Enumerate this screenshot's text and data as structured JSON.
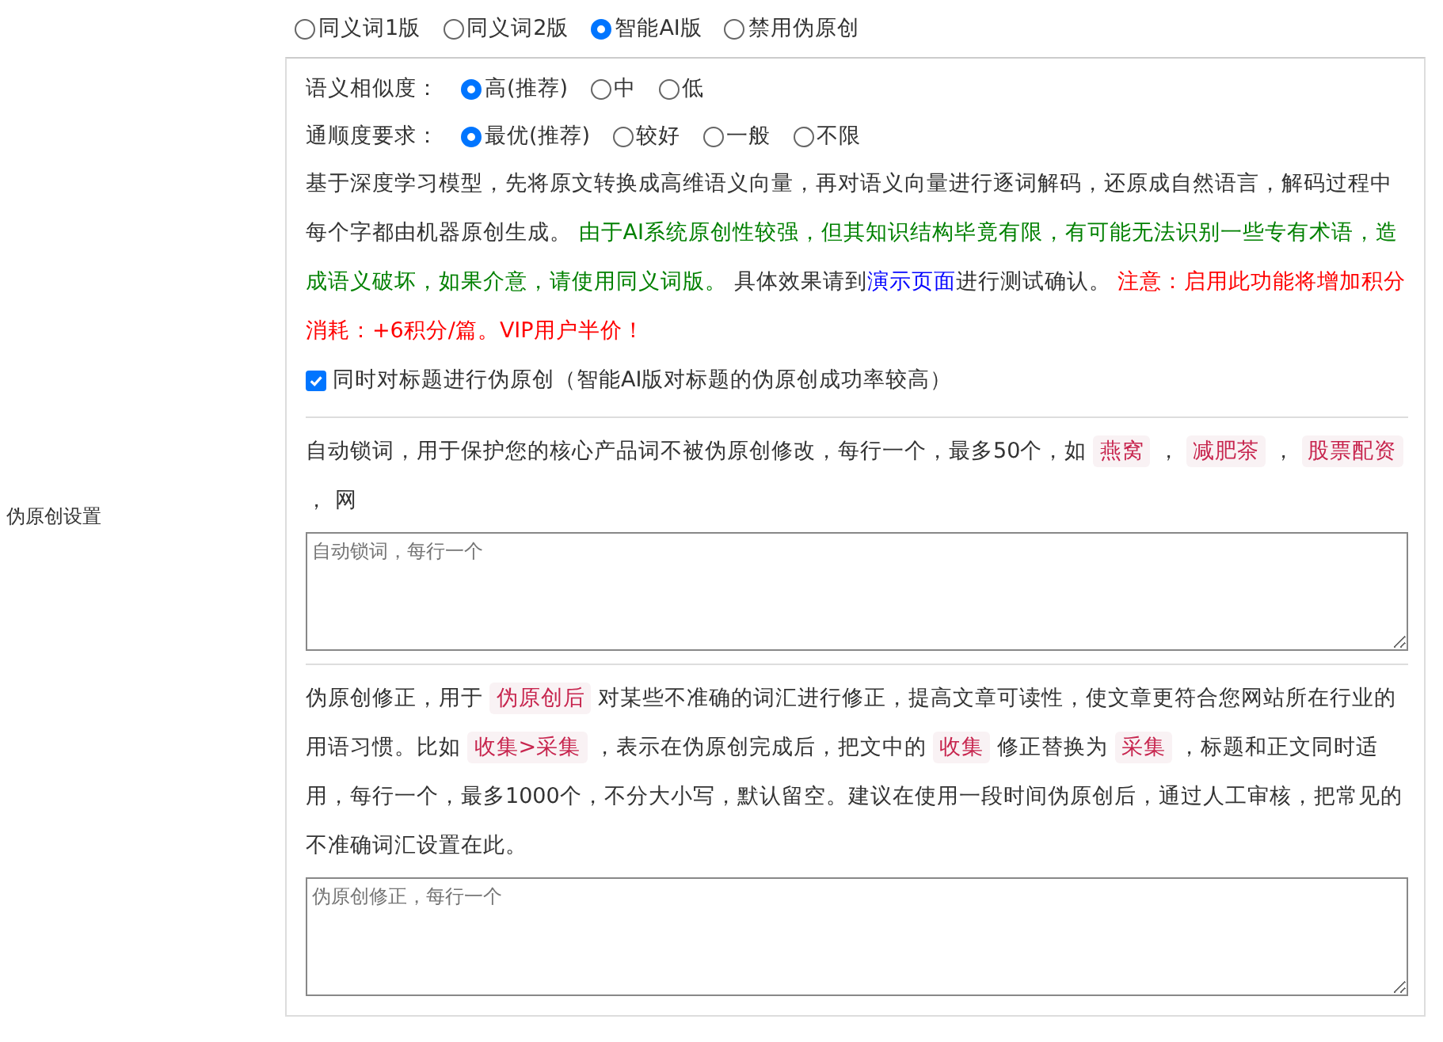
{
  "modes": [
    {
      "label": "同义词1版",
      "selected": false
    },
    {
      "label": "同义词2版",
      "selected": false
    },
    {
      "label": "智能AI版",
      "selected": true
    },
    {
      "label": "禁用伪原创",
      "selected": false
    }
  ],
  "similarity": {
    "label": "语义相似度：",
    "options": [
      {
        "label": "高(推荐)",
        "selected": true
      },
      {
        "label": "中",
        "selected": false
      },
      {
        "label": "低",
        "selected": false
      }
    ]
  },
  "fluency": {
    "label": "通顺度要求：",
    "options": [
      {
        "label": "最优(推荐)",
        "selected": true
      },
      {
        "label": "较好",
        "selected": false
      },
      {
        "label": "一般",
        "selected": false
      },
      {
        "label": "不限",
        "selected": false
      }
    ]
  },
  "ai_description": [
    {
      "kind": "plain",
      "text": "基于深度学习模型，先将原文转换成高维语义向量，再对语义向量进行逐词解码，还原成自然语言，解码过程中每个字都由机器原创生成。 "
    },
    {
      "kind": "note",
      "text": "由于AI系统原创性较强，但其知识结构毕竟有限，有可能无法识别一些专有术语，造成语义破坏，如果介意，请使用同义词版。"
    },
    {
      "kind": "plain",
      "text": " 具体效果请到"
    },
    {
      "kind": "link",
      "text": "演示页面"
    },
    {
      "kind": "plain",
      "text": "进行测试确认。 "
    },
    {
      "kind": "warning",
      "text": "注意：启用此功能将增加积分消耗：+6积分/篇。VIP用户半价！"
    }
  ],
  "title_option": {
    "label": "同时对标题进行伪原创（智能AI版对标题的伪原创成功率较高）",
    "checked": true
  },
  "side_label": "伪原创设置",
  "lock_words": {
    "description": [
      {
        "kind": "plain",
        "text": "自动锁词，用于保护您的核心产品词不被伪原创修改，每行一个，最多50个，如 "
      },
      {
        "kind": "code",
        "text": "燕窝"
      },
      {
        "kind": "plain",
        "text": " ， "
      },
      {
        "kind": "code",
        "text": "减肥茶"
      },
      {
        "kind": "plain",
        "text": " ， "
      },
      {
        "kind": "code",
        "text": "股票配资"
      },
      {
        "kind": "plain",
        "text": " ， 网"
      }
    ],
    "placeholder": "自动锁词，每行一个"
  },
  "correction": {
    "description": [
      {
        "kind": "plain",
        "text": "伪原创修正，用于 "
      },
      {
        "kind": "code",
        "text": "伪原创后"
      },
      {
        "kind": "plain",
        "text": " 对某些不准确的词汇进行修正，提高文章可读性，使文章更符合您网站所在行业的用语习惯。比如 "
      },
      {
        "kind": "code",
        "text": "收集>采集"
      },
      {
        "kind": "plain",
        "text": " ，表示在伪原创完成后，把文中的 "
      },
      {
        "kind": "code",
        "text": "收集"
      },
      {
        "kind": "plain",
        "text": " 修正替换为 "
      },
      {
        "kind": "code",
        "text": "采集"
      },
      {
        "kind": "plain",
        "text": " ，标题和正文同时适用，每行一个，最多1000个，不分大小写，默认留空。建议在使用一段时间伪原创后，通过人工审核，把常见的不准确词汇设置在此。"
      }
    ],
    "placeholder": "伪原创修正，每行一个"
  }
}
